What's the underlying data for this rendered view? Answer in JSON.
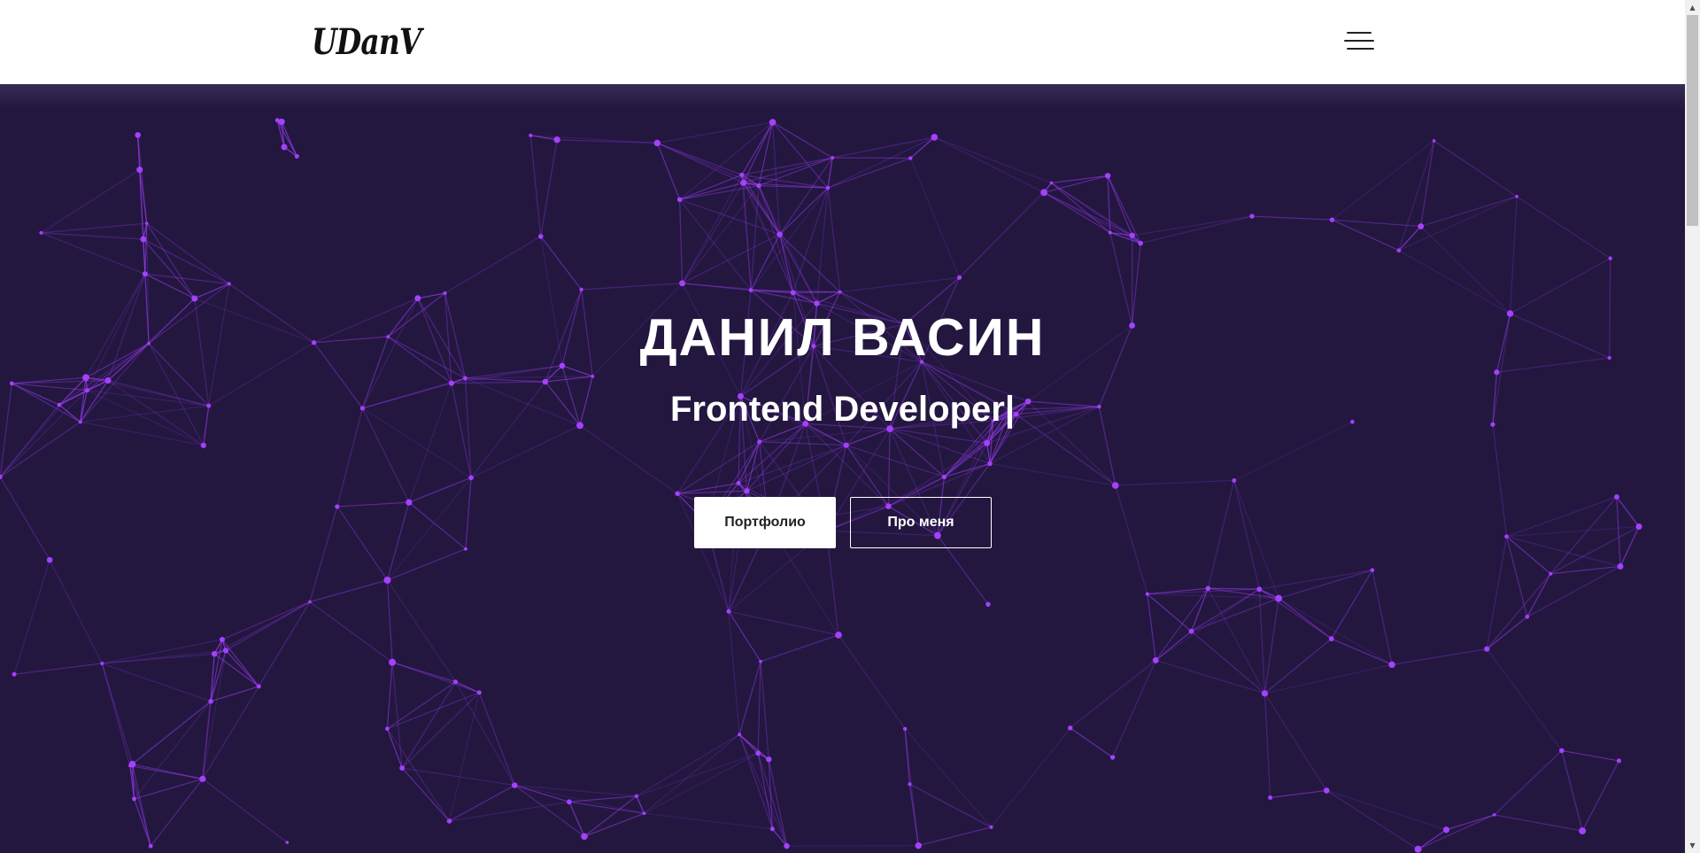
{
  "header": {
    "logo": "UDanV",
    "menu_icon": "hamburger-icon"
  },
  "hero": {
    "title": "ДАНИЛ ВАСИН",
    "subtitle": "Frontend Developer|",
    "buttons": {
      "primary": "Портфолио",
      "secondary": "Про меня"
    },
    "background": "particles-network",
    "colors": {
      "background": "#231740",
      "lines": "#9b3cf0",
      "nodes": "#a540ff"
    }
  },
  "scrollbar": {
    "up_icon": "scroll-up-arrow-icon",
    "down_icon": "scroll-down-arrow-icon"
  }
}
